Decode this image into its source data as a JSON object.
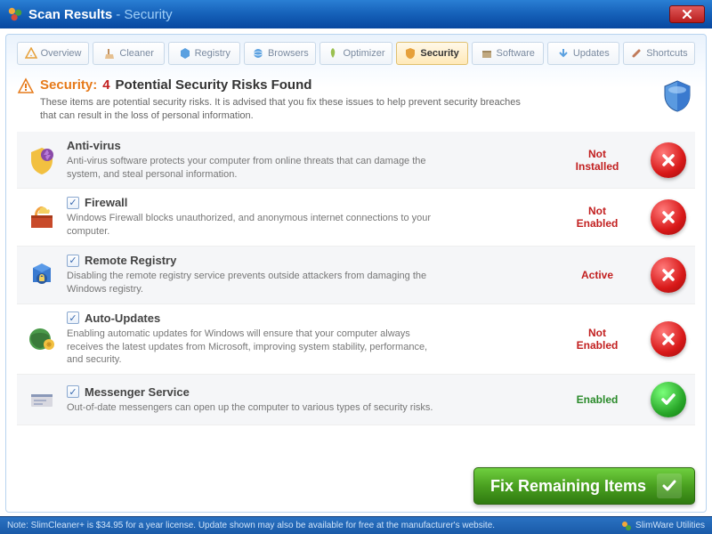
{
  "window": {
    "title1": "Scan Results",
    "title2": "- Security"
  },
  "tabs": [
    {
      "label": "Overview",
      "icon": "warning"
    },
    {
      "label": "Cleaner",
      "icon": "broom"
    },
    {
      "label": "Registry",
      "icon": "cube"
    },
    {
      "label": "Browsers",
      "icon": "globe"
    },
    {
      "label": "Optimizer",
      "icon": "rocket"
    },
    {
      "label": "Security",
      "icon": "shield"
    },
    {
      "label": "Software",
      "icon": "box"
    },
    {
      "label": "Updates",
      "icon": "down"
    },
    {
      "label": "Shortcuts",
      "icon": "link"
    }
  ],
  "heading": {
    "label": "Security:",
    "count": "4",
    "text": "Potential Security Risks Found",
    "desc": "These items are potential security risks. It is advised that you fix these issues to help prevent security breaches that can result in the loss of personal information."
  },
  "items": [
    {
      "title": "Anti-virus",
      "desc": "Anti-virus software protects your computer from online threats that can damage the system, and steal personal information.",
      "status": "Not Installed",
      "ok": false,
      "checked": false
    },
    {
      "title": "Firewall",
      "desc": "Windows Firewall blocks unauthorized, and anonymous internet connections to your computer.",
      "status": "Not Enabled",
      "ok": false,
      "checked": true
    },
    {
      "title": "Remote Registry",
      "desc": "Disabling the remote registry service prevents outside attackers from damaging the Windows registry.",
      "status": "Active",
      "ok": false,
      "checked": true
    },
    {
      "title": "Auto-Updates",
      "desc": "Enabling automatic updates for Windows will ensure that your computer always receives the latest updates from Microsoft, improving system stability, performance, and security.",
      "status": "Not Enabled",
      "ok": false,
      "checked": true
    },
    {
      "title": "Messenger Service",
      "desc": "Out-of-date messengers can open up the computer to various types of security risks.",
      "status": "Enabled",
      "ok": true,
      "checked": true
    }
  ],
  "fix_button": "Fix Remaining Items",
  "statusbar": {
    "note": "Note: SlimCleaner+ is $34.95 for a year license. Update shown may also be available for free at the manufacturer's website.",
    "brand": "SlimWare Utilities"
  }
}
